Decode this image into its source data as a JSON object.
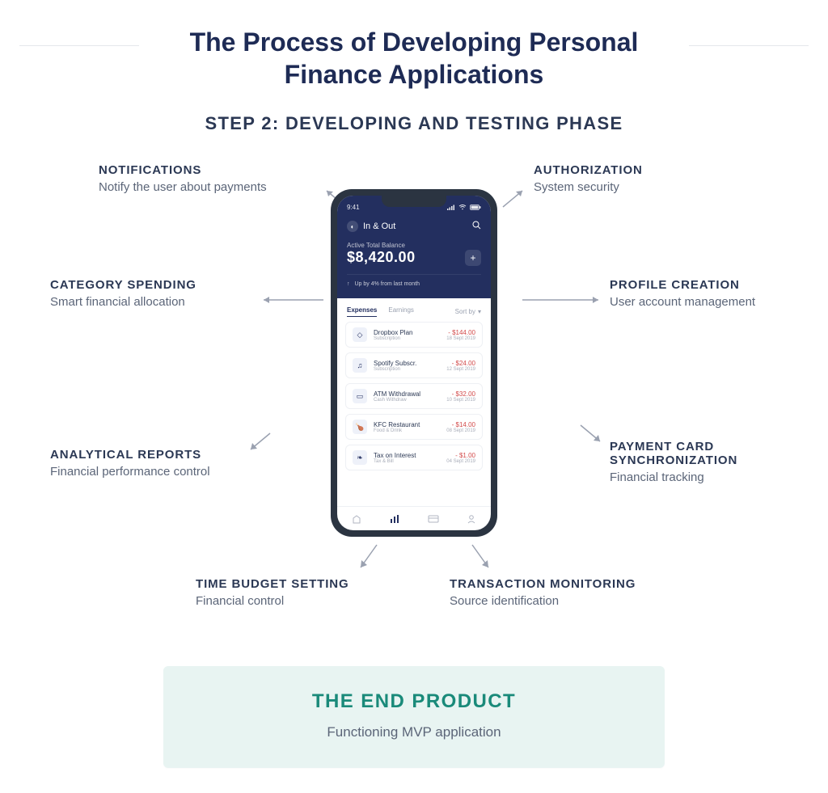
{
  "header": {
    "title": "The Process of Developing Personal Finance Applications",
    "subtitle": "STEP 2: DEVELOPING AND TESTING PHASE"
  },
  "features": {
    "notifications": {
      "title": "NOTIFICATIONS",
      "sub": "Notify the user about payments"
    },
    "authorization": {
      "title": "AUTHORIZATION",
      "sub": "System security"
    },
    "category_spending": {
      "title": "CATEGORY SPENDING",
      "sub": "Smart financial allocation"
    },
    "profile_creation": {
      "title": "PROFILE CREATION",
      "sub": "User account management"
    },
    "analytical_reports": {
      "title": "ANALYTICAL REPORTS",
      "sub": "Financial performance control"
    },
    "payment_card_sync": {
      "title": "PAYMENT CARD SYNCHRONIZATION",
      "sub": "Financial tracking"
    },
    "time_budget": {
      "title": "TIME BUDGET SETTING",
      "sub": "Financial control"
    },
    "transaction_monitoring": {
      "title": "TRANSACTION MONITORING",
      "sub": "Source identification"
    }
  },
  "end": {
    "title": "THE END PRODUCT",
    "sub": "Functioning MVP application"
  },
  "phone": {
    "time": "9:41",
    "app_name": "In & Out",
    "balance_label": "Active Total Balance",
    "balance": "$8,420.00",
    "trend": "Up by 4% from last month",
    "tabs": {
      "expenses": "Expenses",
      "earnings": "Earnings",
      "sort": "Sort by"
    },
    "items": [
      {
        "icon": "dropbox",
        "name": "Dropbox Plan",
        "category": "Subscription",
        "amount": "- $144.00",
        "date": "18 Sept 2019"
      },
      {
        "icon": "music",
        "name": "Spotify Subscr.",
        "category": "Subscription",
        "amount": "- $24.00",
        "date": "12 Sept 2019"
      },
      {
        "icon": "wallet",
        "name": "ATM Withdrawal",
        "category": "Cash Withdraw",
        "amount": "- $32.00",
        "date": "10 Sept 2019"
      },
      {
        "icon": "food",
        "name": "KFC Restaurant",
        "category": "Food & Drink",
        "amount": "- $14.00",
        "date": "08 Sept 2019"
      },
      {
        "icon": "leaf",
        "name": "Tax on Interest",
        "category": "Tax & Bill",
        "amount": "- $1.00",
        "date": "04 Sept 2019"
      }
    ]
  },
  "chart_data": {
    "type": "diagram",
    "center": "Personal finance mobile app mockup",
    "nodes": [
      {
        "id": "notifications",
        "label": "NOTIFICATIONS",
        "desc": "Notify the user about payments",
        "side": "left-top"
      },
      {
        "id": "authorization",
        "label": "AUTHORIZATION",
        "desc": "System security",
        "side": "right-top"
      },
      {
        "id": "category_spending",
        "label": "CATEGORY SPENDING",
        "desc": "Smart financial allocation",
        "side": "left-mid"
      },
      {
        "id": "profile_creation",
        "label": "PROFILE CREATION",
        "desc": "User account management",
        "side": "right-mid"
      },
      {
        "id": "analytical_reports",
        "label": "ANALYTICAL REPORTS",
        "desc": "Financial performance control",
        "side": "left-low"
      },
      {
        "id": "payment_card_sync",
        "label": "PAYMENT CARD SYNCHRONIZATION",
        "desc": "Financial tracking",
        "side": "right-low"
      },
      {
        "id": "time_budget",
        "label": "TIME BUDGET SETTING",
        "desc": "Financial control",
        "side": "bottom-left"
      },
      {
        "id": "transaction_monitoring",
        "label": "TRANSACTION MONITORING",
        "desc": "Source identification",
        "side": "bottom-right"
      }
    ],
    "result": {
      "label": "THE END PRODUCT",
      "desc": "Functioning MVP application"
    }
  }
}
